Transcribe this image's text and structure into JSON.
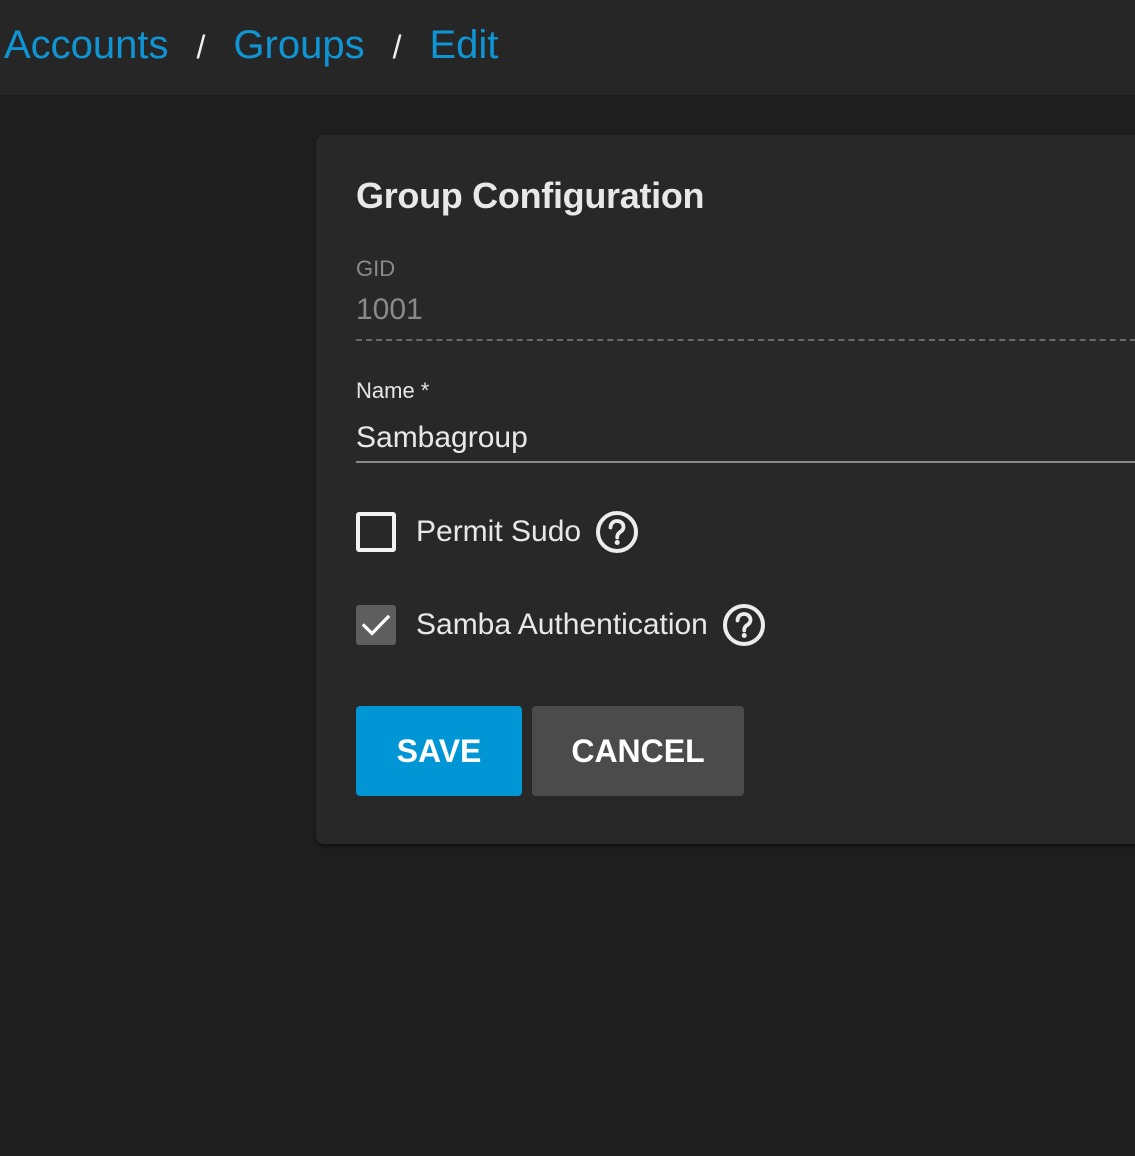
{
  "breadcrumb": {
    "items": [
      "Accounts",
      "Groups",
      "Edit"
    ],
    "separator": "/"
  },
  "form": {
    "title": "Group Configuration",
    "gid": {
      "label": "GID",
      "value": "1001"
    },
    "name": {
      "label": "Name *",
      "value": "Sambagroup"
    },
    "permit_sudo": {
      "label": "Permit Sudo",
      "checked": false,
      "help_icon": "help-circle-icon"
    },
    "samba_auth": {
      "label": "Samba Authentication",
      "checked": true,
      "help_icon": "help-circle-icon"
    },
    "save_label": "SAVE",
    "cancel_label": "CANCEL"
  },
  "colors": {
    "accent": "#0095d5",
    "link": "#0f95d4",
    "background": "#1e1e1e",
    "card": "#282828",
    "cancel": "#4b4b4b"
  }
}
